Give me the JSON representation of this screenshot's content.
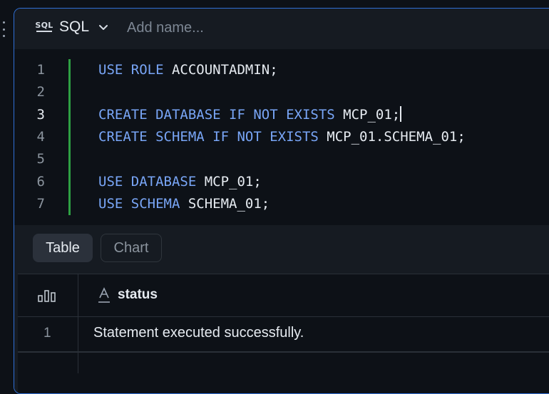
{
  "header": {
    "language_icon_text": "SQL",
    "language_label": "SQL",
    "name_placeholder": "Add name..."
  },
  "editor": {
    "lines": [
      {
        "number": "1",
        "tokens": [
          {
            "t": "USE ROLE ",
            "k": "kw"
          },
          {
            "t": "ACCOUNTADMIN;",
            "k": "id"
          }
        ]
      },
      {
        "number": "2",
        "tokens": []
      },
      {
        "number": "3",
        "tokens": [
          {
            "t": "CREATE DATABASE IF NOT EXISTS ",
            "k": "kw"
          },
          {
            "t": "MCP_01;",
            "k": "id"
          }
        ]
      },
      {
        "number": "4",
        "tokens": [
          {
            "t": "CREATE SCHEMA IF NOT EXISTS ",
            "k": "kw"
          },
          {
            "t": "MCP_01.SCHEMA_01;",
            "k": "id"
          }
        ]
      },
      {
        "number": "5",
        "tokens": []
      },
      {
        "number": "6",
        "tokens": [
          {
            "t": "USE DATABASE ",
            "k": "kw"
          },
          {
            "t": "MCP_01;",
            "k": "id"
          }
        ]
      },
      {
        "number": "7",
        "tokens": [
          {
            "t": "USE SCHEMA ",
            "k": "kw"
          },
          {
            "t": "SCHEMA_01;",
            "k": "id"
          }
        ]
      }
    ],
    "active_line": 3
  },
  "results": {
    "tabs": [
      {
        "label": "Table",
        "selected": true
      },
      {
        "label": "Chart",
        "selected": false
      }
    ],
    "columns": [
      {
        "name": "status",
        "type_icon": "text-type-icon"
      }
    ],
    "rows": [
      {
        "number": "1",
        "status": "Statement executed successfully."
      }
    ]
  },
  "colors": {
    "keyword": "#79a6f7",
    "identifier": "#e6ebf1",
    "cell_border": "#2f6fd6",
    "modified_gutter": "#2ea043"
  }
}
